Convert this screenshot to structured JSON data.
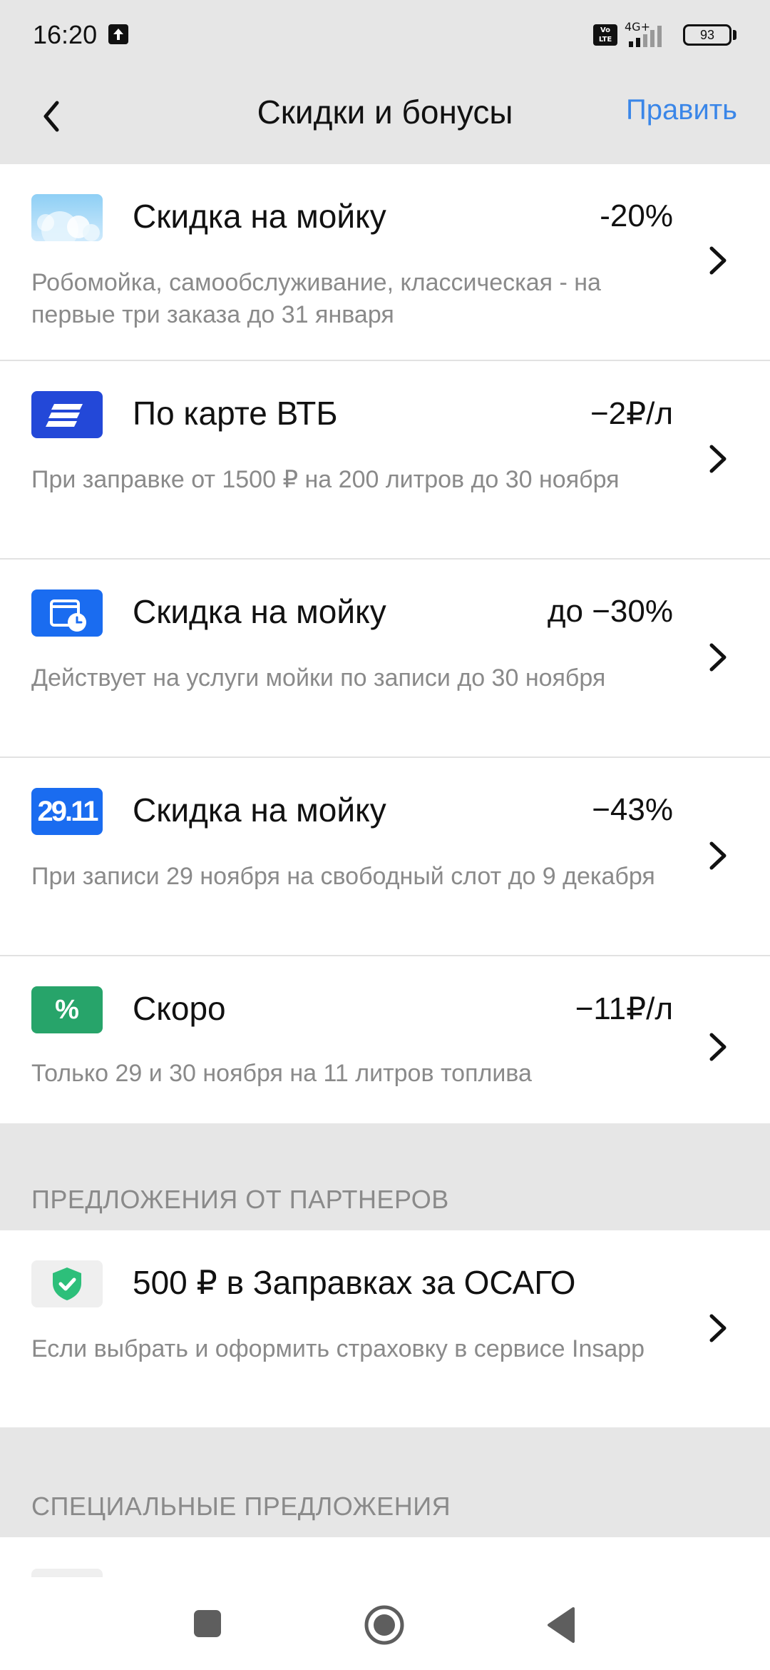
{
  "status_bar": {
    "time": "16:20",
    "network": "4G+",
    "volte": "Vo LTE",
    "battery": "93"
  },
  "header": {
    "title": "Скидки и бонусы",
    "edit_label": "Править"
  },
  "discounts": [
    {
      "icon": "car-wash-bubbles-icon",
      "title": "Скидка на мойку",
      "value": "-20%",
      "description": "Робомойка, самообслуживание, классическая - на первые три заказа до 31 января"
    },
    {
      "icon": "vtb-card-icon",
      "title": "По карте ВТБ",
      "value": "−2₽/л",
      "description": "При заправке от 1500 ₽ на 200 литров до 30 ноября"
    },
    {
      "icon": "calendar-clock-icon",
      "title": "Скидка на мойку",
      "value": "до −30%",
      "description": "Действует на услуги мойки по записи до 30 ноября"
    },
    {
      "icon": "date-badge-icon",
      "badge_text": "29.11",
      "title": "Скидка на мойку",
      "value": "−43%",
      "description": "При записи 29 ноября на свободный слот до 9 декабря"
    },
    {
      "icon": "percent-badge-icon",
      "badge_text": "%",
      "title": "Скоро",
      "value": "−11₽/л",
      "description": "Только 29 и 30 ноября на 11 литров топлива"
    }
  ],
  "partners_section": {
    "label": "ПРЕДЛОЖЕНИЯ ОТ ПАРТНЕРОВ",
    "items": [
      {
        "icon": "shield-check-icon",
        "title": "500 ₽ в Заправках за ОСАГО",
        "description": "Если выбрать и оформить страховку в сервисе Insapp"
      }
    ]
  },
  "special_section": {
    "label": "СПЕЦИАЛЬНЫЕ ПРЕДЛОЖЕНИЯ"
  },
  "colors": {
    "accent": "#3a86e8",
    "vtb_blue": "#2348d8",
    "wash_blue": "#1a6cf0",
    "green": "#27a46a",
    "background": "#e6e6e6"
  }
}
